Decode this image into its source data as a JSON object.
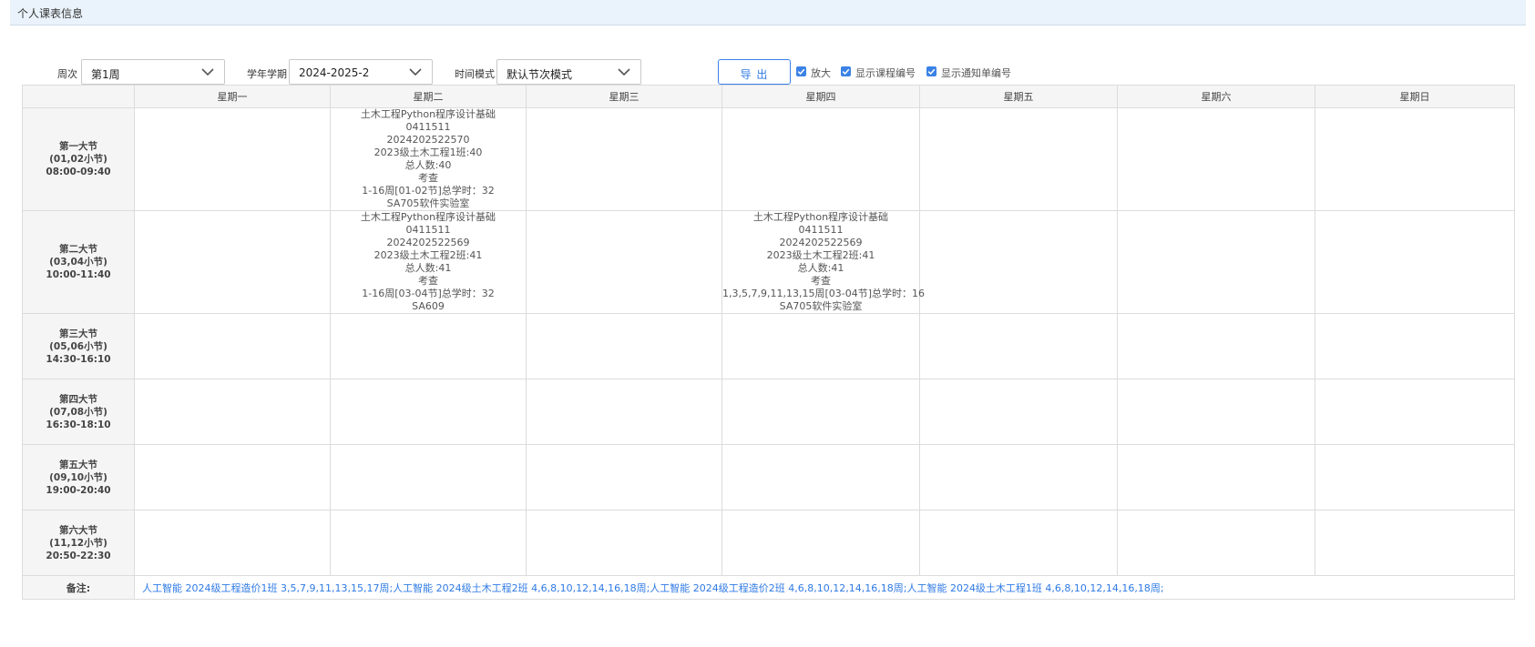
{
  "header": {
    "title": "个人课表信息"
  },
  "toolbar": {
    "week": {
      "label": "周次",
      "value": "第1周"
    },
    "term": {
      "label": "学年学期",
      "value": "2024-2025-2"
    },
    "time_mode": {
      "label": "时间模式",
      "value": "默认节次模式"
    },
    "export_label": "导 出",
    "checkboxes": [
      {
        "label": "放大",
        "checked": true
      },
      {
        "label": "显示课程编号",
        "checked": true
      },
      {
        "label": "显示通知单编号",
        "checked": true
      }
    ]
  },
  "schedule": {
    "days": [
      "星期一",
      "星期二",
      "星期三",
      "星期四",
      "星期五",
      "星期六",
      "星期日"
    ],
    "periods": [
      {
        "name": "第一大节",
        "sub": "(01,02小节)",
        "time": "08:00-09:40"
      },
      {
        "name": "第二大节",
        "sub": "(03,04小节)",
        "time": "10:00-11:40"
      },
      {
        "name": "第三大节",
        "sub": "(05,06小节)",
        "time": "14:30-16:10"
      },
      {
        "name": "第四大节",
        "sub": "(07,08小节)",
        "time": "16:30-18:10"
      },
      {
        "name": "第五大节",
        "sub": "(09,10小节)",
        "time": "19:00-20:40"
      },
      {
        "name": "第六大节",
        "sub": "(11,12小节)",
        "time": "20:50-22:30"
      }
    ],
    "courses": [
      {
        "period": 0,
        "day": 1,
        "lines": [
          "土木工程Python程序设计基础",
          "0411511",
          "2024202522570",
          "2023级土木工程1班:40",
          "总人数:40",
          "考查",
          "1-16周[01-02节]总学时：32",
          "SA705软件实验室"
        ]
      },
      {
        "period": 1,
        "day": 1,
        "lines": [
          "土木工程Python程序设计基础",
          "0411511",
          "2024202522569",
          "2023级土木工程2班:41",
          "总人数:41",
          "考查",
          "1-16周[03-04节]总学时：32",
          "SA609"
        ]
      },
      {
        "period": 1,
        "day": 3,
        "lines": [
          "土木工程Python程序设计基础",
          "0411511",
          "2024202522569",
          "2023级土木工程2班:41",
          "总人数:41",
          "考查",
          "1,3,5,7,9,11,13,15周[03-04节]总学时：16",
          "SA705软件实验室"
        ]
      }
    ],
    "remark_label": "备注:",
    "remark_text": "人工智能 2024级工程造价1班 3,5,7,9,11,13,15,17周;人工智能 2024级土木工程2班 4,6,8,10,12,14,16,18周;人工智能 2024级工程造价2班 4,6,8,10,12,14,16,18周;人工智能 2024级土木工程1班 4,6,8,10,12,14,16,18周;"
  },
  "icons": {
    "dropdown": "chevron-down-icon",
    "check": "check-icon"
  },
  "colors": {
    "accent": "#3b82e6",
    "link": "#2f7ae5",
    "header_bg": "#eaf3fb"
  }
}
